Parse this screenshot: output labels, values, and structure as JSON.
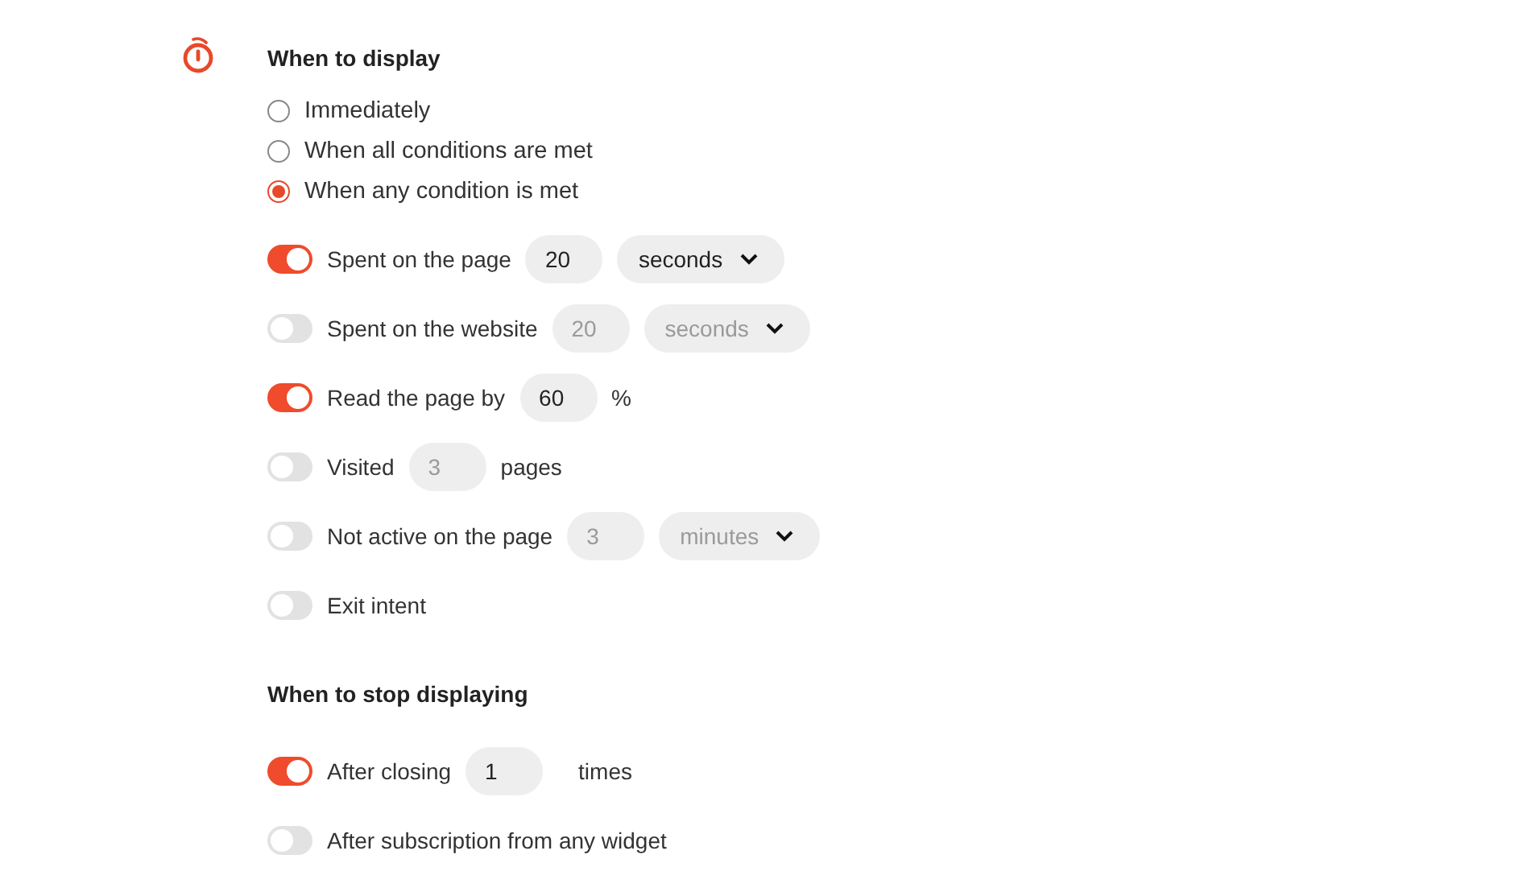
{
  "display": {
    "title": "When to display",
    "modes": [
      {
        "label": "Immediately",
        "selected": false
      },
      {
        "label": "When all conditions are met",
        "selected": false
      },
      {
        "label": "When any condition is met",
        "selected": true
      }
    ],
    "conditions": [
      {
        "label": "Spent on the page",
        "on": true,
        "parts": [
          {
            "kind": "field",
            "value": "20"
          },
          {
            "kind": "select",
            "value": "seconds"
          }
        ]
      },
      {
        "label": "Spent on the website",
        "on": false,
        "parts": [
          {
            "kind": "field",
            "value": "20"
          },
          {
            "kind": "select",
            "value": "seconds"
          }
        ]
      },
      {
        "label": "Read the page by",
        "on": true,
        "parts": [
          {
            "kind": "field",
            "value": "60"
          },
          {
            "kind": "text",
            "value": "%"
          }
        ]
      },
      {
        "label": "Visited",
        "on": false,
        "parts": [
          {
            "kind": "field",
            "value": "3"
          },
          {
            "kind": "text",
            "value": "pages"
          }
        ]
      },
      {
        "label": "Not active on the page",
        "on": false,
        "parts": [
          {
            "kind": "field",
            "value": "3"
          },
          {
            "kind": "select",
            "value": "minutes"
          }
        ]
      },
      {
        "label": "Exit intent",
        "on": false
      }
    ]
  },
  "stop": {
    "title": "When to stop displaying",
    "conditions": [
      {
        "label": "After closing",
        "on": true,
        "parts": [
          {
            "kind": "field",
            "value": "1"
          },
          {
            "kind": "text",
            "value": "times"
          }
        ]
      },
      {
        "label": "After subscription from any widget",
        "on": false
      }
    ]
  }
}
